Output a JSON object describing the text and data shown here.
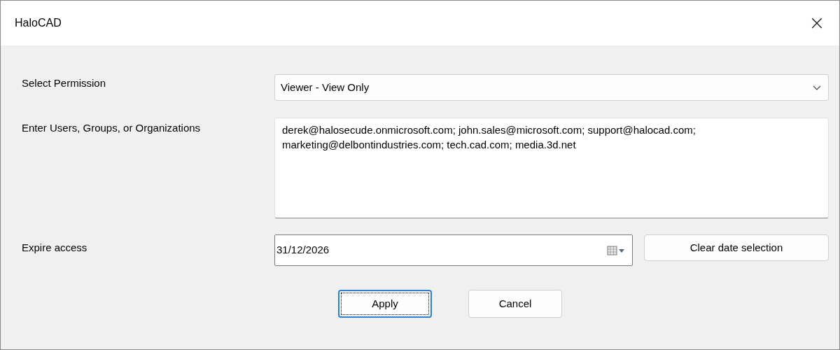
{
  "window": {
    "title": "HaloCAD",
    "close": "×"
  },
  "permission": {
    "label": "Select Permission",
    "value": "Viewer - View Only"
  },
  "recipients": {
    "label": "Enter Users, Groups, or Organizations",
    "value": "derek@halosecude.onmicrosoft.com; john.sales@microsoft.com; support@halocad.com; marketing@delbontindustries.com; tech.cad.com; media.3d.net"
  },
  "expire": {
    "label": "Expire access",
    "value": "31/12/2026",
    "clear_button": "Clear date selection"
  },
  "buttons": [
    {
      "label": "Apply",
      "focused": true
    },
    {
      "label": "Cancel",
      "focused": false
    }
  ]
}
